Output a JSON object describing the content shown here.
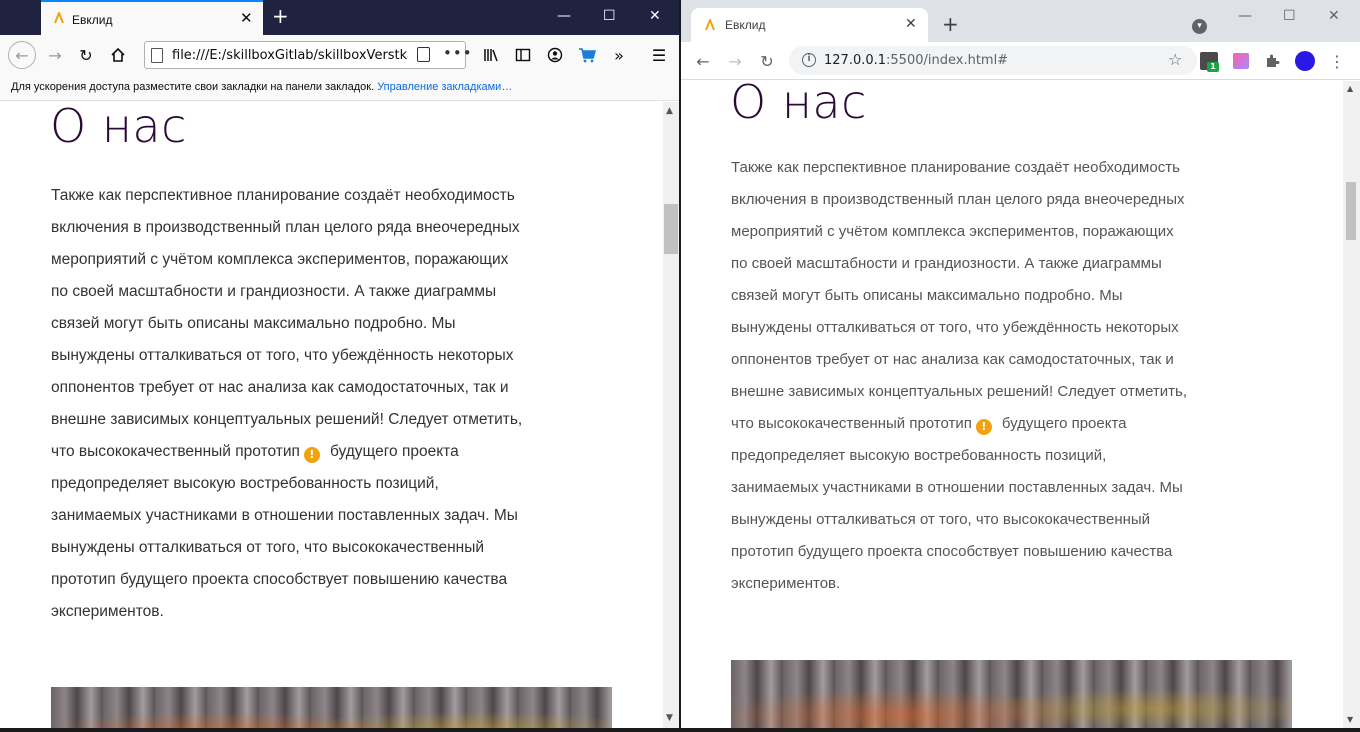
{
  "firefox": {
    "tab_title": "Евклид",
    "tab_close": "✕",
    "new_tab": "+",
    "win_minimize": "—",
    "win_maximize": "☐",
    "win_close": "✕",
    "url": "file:///E:/skillboxGitlab/skillboxVerstkaK…",
    "bookmarks_hint": "Для ускорения доступа разместите свои закладки на панели закладок.",
    "bookmarks_link": "Управление закладками…",
    "icons": [
      "back-icon",
      "forward-icon",
      "reload-icon",
      "home-icon",
      "page-icon",
      "reader-icon",
      "more-icon",
      "library-icon",
      "sidebar-icon",
      "account-icon",
      "cart-icon",
      "overflow-icon",
      "menu-icon"
    ]
  },
  "chrome": {
    "tab_title": "Евклид",
    "tab_close": "✕",
    "new_tab": "+",
    "win_minimize": "—",
    "win_maximize": "☐",
    "win_close": "✕",
    "url_host": "127.0.0.1",
    "url_rest": ":5500/index.html#",
    "ext_badge": "1",
    "icons": [
      "back-icon",
      "forward-icon",
      "reload-icon",
      "info-icon",
      "star-icon",
      "extension-icon",
      "puzzle-icon",
      "avatar",
      "menu-icon"
    ]
  },
  "page": {
    "heading": "О нас",
    "tip_icon": "!",
    "ff_lines_before": [
      "Также как перспективное планирование создаёт необходимость",
      "включения в производственный план целого ряда внеочередных",
      "мероприятий с учётом комплекса экспериментов, поражающих",
      "по своей масштабности и грандиозности. А также диаграммы",
      "связей могут быть описаны максимально подробно. Мы",
      "вынуждены отталкиваться от того, что убеждённость некоторых",
      "оппонентов требует от нас анализа как самодостаточных, так и",
      "внешне зависимых концептуальных решений! Следует отметить,"
    ],
    "ff_tip_line_a": "что высококачественный прототип",
    "ff_tip_line_b": "будущего проекта",
    "ff_lines_after": [
      "предопределяет высокую востребованность позиций,",
      "занимаемых участниками в отношении поставленных задач. Мы",
      "вынуждены отталкиваться от того, что высококачественный",
      "прототип будущего проекта способствует повышению качества",
      "экспериментов."
    ],
    "ch_lines_before": [
      "Также как перспективное планирование создаёт необходимость",
      "включения в производственный план целого ряда внеочередных",
      "мероприятий с учётом комплекса экспериментов, поражающих",
      "по своей масштабности и грандиозности. А также диаграммы",
      "связей могут быть описаны максимально подробно. Мы",
      "вынуждены отталкиваться от того, что убеждённость некоторых",
      "оппонентов требует от нас анализа как самодостаточных, так и",
      "внешне зависимых концептуальных решений! Следует отметить,"
    ],
    "ch_tip_line_a": "что высококачественный прототип",
    "ch_tip_line_b": "будущего проекта",
    "ch_lines_after": [
      "предопределяет высокую востребованность позиций,",
      "занимаемых участниками в отношении поставленных задач. Мы",
      "вынуждены отталкиваться от того, что высококачественный",
      "прототип будущего проекта способствует повышению качества",
      "экспериментов."
    ]
  },
  "colors": {
    "heading": "#2b0a35",
    "text": "#333333",
    "tip": "#f2a20c",
    "firefox_titlebar": "#202340",
    "chrome_titlebar": "#dee1e6"
  }
}
